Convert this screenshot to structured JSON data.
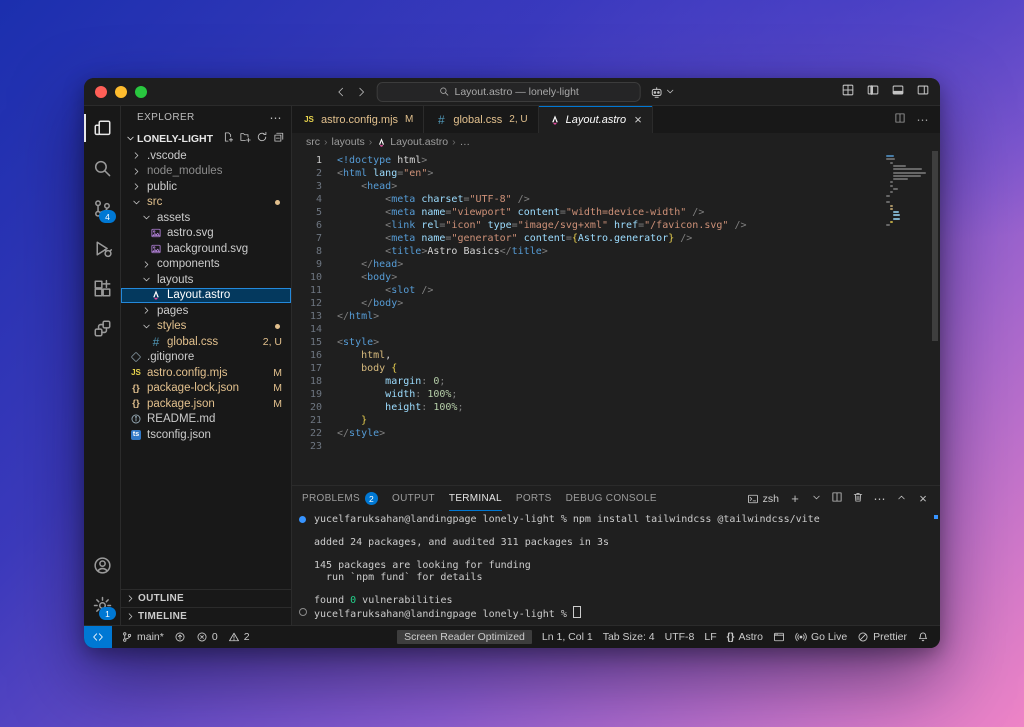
{
  "window": {
    "search_text": "Layout.astro — lonely-light"
  },
  "colors": {
    "accent": "#0078d4",
    "modified_gold": "#e2c08d",
    "selection_bg": "#04395e",
    "remote_blue": "#0078d4",
    "badge_blue": "#0078d4"
  },
  "palette": {
    "p": "#808080",
    "t": "#569cd6",
    "a": "#9cdcfe",
    "s": "#ce9178",
    "w": "#d4d4d4",
    "y": "#e8cf4f",
    "g": "#d7ba7d",
    "v": "#b5cea8",
    "green": "#23d18b"
  },
  "titlebar": {
    "layout_icons": [
      "layout-grid",
      "panel-left",
      "panel-bottom",
      "panel-right"
    ]
  },
  "activity_bar": {
    "top": [
      {
        "name": "explorer",
        "icon": "files",
        "active": true
      },
      {
        "name": "search",
        "icon": "search"
      },
      {
        "name": "source-control",
        "icon": "scm",
        "badge": "4"
      },
      {
        "name": "run-debug",
        "icon": "debug"
      },
      {
        "name": "extensions",
        "icon": "extensions"
      },
      {
        "name": "remote-explorer",
        "icon": "remote"
      }
    ],
    "bottom": [
      {
        "name": "account",
        "icon": "account"
      },
      {
        "name": "settings",
        "icon": "gear",
        "badge": "1"
      }
    ]
  },
  "explorer": {
    "title": "EXPLORER",
    "project": "LONELY-LIGHT",
    "tree": [
      {
        "label": ".vscode",
        "indent": 1,
        "chev": "r"
      },
      {
        "label": "node_modules",
        "indent": 1,
        "chev": "r",
        "dim": true
      },
      {
        "label": "public",
        "indent": 1,
        "chev": "r"
      },
      {
        "label": "src",
        "indent": 1,
        "chev": "d",
        "gold": true,
        "dot": true
      },
      {
        "label": "assets",
        "indent": 2,
        "chev": "d"
      },
      {
        "label": "astro.svg",
        "indent": 3,
        "icon": "svgfile"
      },
      {
        "label": "background.svg",
        "indent": 3,
        "icon": "svgfile"
      },
      {
        "label": "components",
        "indent": 2,
        "chev": "r"
      },
      {
        "label": "layouts",
        "indent": 2,
        "chev": "d"
      },
      {
        "label": "Layout.astro",
        "indent": 3,
        "icon": "astro",
        "selected": true
      },
      {
        "label": "pages",
        "indent": 2,
        "chev": "r"
      },
      {
        "label": "styles",
        "indent": 2,
        "chev": "d",
        "gold": true,
        "dot": true
      },
      {
        "label": "global.css",
        "indent": 3,
        "icon": "hash",
        "gold": true,
        "badge": "2, U"
      },
      {
        "label": ".gitignore",
        "indent": 1,
        "icon": "git"
      },
      {
        "label": "astro.config.mjs",
        "indent": 1,
        "icon": "js",
        "gold": true,
        "badge": "M"
      },
      {
        "label": "package-lock.json",
        "indent": 1,
        "icon": "braces",
        "gold": true,
        "badge": "M"
      },
      {
        "label": "package.json",
        "indent": 1,
        "icon": "braces",
        "gold": true,
        "badge": "M"
      },
      {
        "label": "README.md",
        "indent": 1,
        "icon": "info"
      },
      {
        "label": "tsconfig.json",
        "indent": 1,
        "icon": "ts"
      }
    ],
    "sections": [
      {
        "label": "OUTLINE"
      },
      {
        "label": "TIMELINE"
      }
    ]
  },
  "tabs": {
    "items": [
      {
        "icon": "js",
        "label": "astro.config.mjs",
        "badge": "M"
      },
      {
        "icon": "hash",
        "label": "global.css",
        "badge": "2, U"
      },
      {
        "icon": "astro",
        "label": "Layout.astro",
        "active": true,
        "close": "×"
      }
    ]
  },
  "breadcrumb": {
    "parts": [
      {
        "label": "src"
      },
      {
        "label": "layouts"
      },
      {
        "label": "Layout.astro",
        "icon": "astro"
      },
      {
        "label": "…"
      }
    ]
  },
  "editor": {
    "lines": [
      {
        "n": "1",
        "tokens": [
          [
            "t",
            "<!doctype"
          ],
          [
            "w",
            " html"
          ],
          [
            "p",
            ">"
          ]
        ]
      },
      {
        "n": "2",
        "tokens": [
          [
            "p",
            "<"
          ],
          [
            "t",
            "html"
          ],
          [
            "a",
            " lang"
          ],
          [
            "p",
            "="
          ],
          [
            "s",
            "\"en\""
          ],
          [
            "p",
            ">"
          ]
        ]
      },
      {
        "n": "3",
        "tokens": [
          [
            "w",
            "    "
          ],
          [
            "p",
            "<"
          ],
          [
            "t",
            "head"
          ],
          [
            "p",
            ">"
          ]
        ]
      },
      {
        "n": "4",
        "tokens": [
          [
            "w",
            "        "
          ],
          [
            "p",
            "<"
          ],
          [
            "t",
            "meta"
          ],
          [
            "a",
            " charset"
          ],
          [
            "p",
            "="
          ],
          [
            "s",
            "\"UTF-8\""
          ],
          [
            "p",
            " />"
          ]
        ]
      },
      {
        "n": "5",
        "tokens": [
          [
            "w",
            "        "
          ],
          [
            "p",
            "<"
          ],
          [
            "t",
            "meta"
          ],
          [
            "a",
            " name"
          ],
          [
            "p",
            "="
          ],
          [
            "s",
            "\"viewport\""
          ],
          [
            "a",
            " content"
          ],
          [
            "p",
            "="
          ],
          [
            "s",
            "\"width=device-width\""
          ],
          [
            "p",
            " />"
          ]
        ]
      },
      {
        "n": "6",
        "tokens": [
          [
            "w",
            "        "
          ],
          [
            "p",
            "<"
          ],
          [
            "t",
            "link"
          ],
          [
            "a",
            " rel"
          ],
          [
            "p",
            "="
          ],
          [
            "s",
            "\"icon\""
          ],
          [
            "a",
            " type"
          ],
          [
            "p",
            "="
          ],
          [
            "s",
            "\"image/svg+xml\""
          ],
          [
            "a",
            " href"
          ],
          [
            "p",
            "="
          ],
          [
            "s",
            "\"/favicon.svg\""
          ],
          [
            "p",
            " />"
          ]
        ]
      },
      {
        "n": "7",
        "tokens": [
          [
            "w",
            "        "
          ],
          [
            "p",
            "<"
          ],
          [
            "t",
            "meta"
          ],
          [
            "a",
            " name"
          ],
          [
            "p",
            "="
          ],
          [
            "s",
            "\"generator\""
          ],
          [
            "a",
            " content"
          ],
          [
            "p",
            "="
          ],
          [
            "y",
            "{"
          ],
          [
            "a",
            "Astro.generator"
          ],
          [
            "y",
            "}"
          ],
          [
            "p",
            " />"
          ]
        ]
      },
      {
        "n": "8",
        "tokens": [
          [
            "w",
            "        "
          ],
          [
            "p",
            "<"
          ],
          [
            "t",
            "title"
          ],
          [
            "p",
            ">"
          ],
          [
            "w",
            "Astro Basics"
          ],
          [
            "p",
            "</"
          ],
          [
            "t",
            "title"
          ],
          [
            "p",
            ">"
          ]
        ]
      },
      {
        "n": "9",
        "tokens": [
          [
            "w",
            "    "
          ],
          [
            "p",
            "</"
          ],
          [
            "t",
            "head"
          ],
          [
            "p",
            ">"
          ]
        ]
      },
      {
        "n": "10",
        "tokens": [
          [
            "w",
            "    "
          ],
          [
            "p",
            "<"
          ],
          [
            "t",
            "body"
          ],
          [
            "p",
            ">"
          ]
        ]
      },
      {
        "n": "11",
        "tokens": [
          [
            "w",
            "        "
          ],
          [
            "p",
            "<"
          ],
          [
            "t",
            "slot"
          ],
          [
            "p",
            " />"
          ]
        ]
      },
      {
        "n": "12",
        "tokens": [
          [
            "w",
            "    "
          ],
          [
            "p",
            "</"
          ],
          [
            "t",
            "body"
          ],
          [
            "p",
            ">"
          ]
        ]
      },
      {
        "n": "13",
        "tokens": [
          [
            "p",
            "</"
          ],
          [
            "t",
            "html"
          ],
          [
            "p",
            ">"
          ]
        ]
      },
      {
        "n": "14",
        "tokens": []
      },
      {
        "n": "15",
        "tokens": [
          [
            "p",
            "<"
          ],
          [
            "t",
            "style"
          ],
          [
            "p",
            ">"
          ]
        ]
      },
      {
        "n": "16",
        "tokens": [
          [
            "w",
            "    "
          ],
          [
            "g",
            "html"
          ],
          [
            "w",
            ","
          ]
        ]
      },
      {
        "n": "17",
        "tokens": [
          [
            "w",
            "    "
          ],
          [
            "g",
            "body"
          ],
          [
            "y",
            " {"
          ]
        ]
      },
      {
        "n": "18",
        "tokens": [
          [
            "w",
            "        "
          ],
          [
            "a",
            "margin"
          ],
          [
            "p",
            ":"
          ],
          [
            "v",
            " 0"
          ],
          [
            "p",
            ";"
          ]
        ]
      },
      {
        "n": "19",
        "tokens": [
          [
            "w",
            "        "
          ],
          [
            "a",
            "width"
          ],
          [
            "p",
            ":"
          ],
          [
            "v",
            " 100%"
          ],
          [
            "p",
            ";"
          ]
        ]
      },
      {
        "n": "20",
        "tokens": [
          [
            "w",
            "        "
          ],
          [
            "a",
            "height"
          ],
          [
            "p",
            ":"
          ],
          [
            "v",
            " 100%"
          ],
          [
            "p",
            ";"
          ]
        ]
      },
      {
        "n": "21",
        "tokens": [
          [
            "w",
            "    "
          ],
          [
            "y",
            "}"
          ]
        ]
      },
      {
        "n": "22",
        "tokens": [
          [
            "p",
            "</"
          ],
          [
            "t",
            "style"
          ],
          [
            "p",
            ">"
          ]
        ]
      },
      {
        "n": "23",
        "tokens": []
      }
    ]
  },
  "panel": {
    "tabs": [
      {
        "label": "PROBLEMS",
        "badge": "2"
      },
      {
        "label": "OUTPUT"
      },
      {
        "label": "TERMINAL",
        "active": true
      },
      {
        "label": "PORTS"
      },
      {
        "label": "DEBUG CONSOLE"
      }
    ],
    "shell_label": "zsh",
    "terminal": {
      "lines": [
        {
          "deco": "dot",
          "tokens": [
            [
              "w",
              "yucelfaruksahan@landingpage lonely-light % npm install tailwindcss @tailwindcss/vite"
            ]
          ]
        },
        {
          "tokens": []
        },
        {
          "tokens": [
            [
              "w",
              "added 24 packages, and audited 311 packages in 3s"
            ]
          ]
        },
        {
          "tokens": []
        },
        {
          "tokens": [
            [
              "w",
              "145 packages are looking for funding"
            ]
          ]
        },
        {
          "tokens": [
            [
              "w",
              "  run `npm fund` for details"
            ]
          ]
        },
        {
          "tokens": []
        },
        {
          "tokens": [
            [
              "w",
              "found "
            ],
            [
              "green",
              "0"
            ],
            [
              "w",
              " vulnerabilities"
            ]
          ]
        },
        {
          "deco": "circle",
          "cursor": true,
          "tokens": [
            [
              "w",
              "yucelfaruksahan@landingpage lonely-light % "
            ]
          ]
        }
      ]
    }
  },
  "status_bar": {
    "left": [
      {
        "icon": "branch",
        "label": "main*"
      },
      {
        "icon": "sync"
      },
      {
        "icon": "error",
        "label": "0"
      },
      {
        "icon": "warn",
        "label": "2"
      }
    ],
    "right": [
      {
        "label": "Screen Reader Optimized",
        "boxed": true
      },
      {
        "label": "Ln 1, Col 1"
      },
      {
        "label": "Tab Size: 4"
      },
      {
        "label": "UTF-8"
      },
      {
        "label": "LF"
      },
      {
        "icon": "braces-sb",
        "label": "Astro"
      },
      {
        "icon": "browser"
      },
      {
        "icon": "broadcast",
        "label": "Go Live"
      },
      {
        "icon": "slash-circle",
        "label": "Prettier"
      },
      {
        "icon": "bell"
      }
    ]
  }
}
